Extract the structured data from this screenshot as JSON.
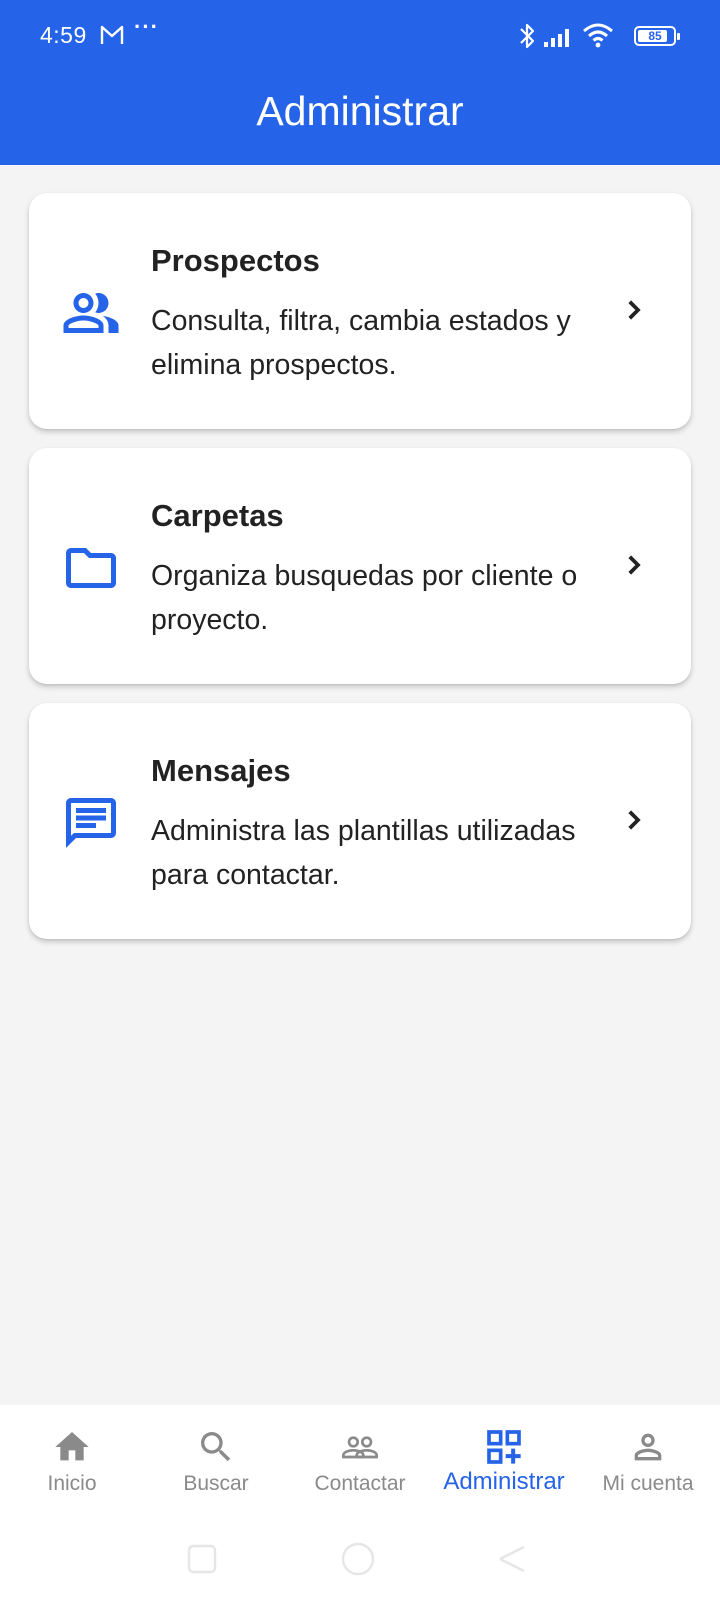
{
  "status_bar": {
    "time": "4:59",
    "battery": "85",
    "battery_percent": 85
  },
  "header": {
    "title": "Administrar"
  },
  "cards": [
    {
      "title": "Prospectos",
      "description": "Consulta, filtra, cambia estados y elimina prospectos.",
      "icon": "people-icon"
    },
    {
      "title": "Carpetas",
      "description": "Organiza busquedas por cliente o proyecto.",
      "icon": "folder-icon"
    },
    {
      "title": "Mensajes",
      "description": "Administra las plantillas utilizadas para contactar.",
      "icon": "message-icon"
    }
  ],
  "bottom_nav": {
    "items": [
      {
        "label": "Inicio",
        "icon": "home-icon",
        "active": false
      },
      {
        "label": "Buscar",
        "icon": "search-icon",
        "active": false
      },
      {
        "label": "Contactar",
        "icon": "contacts-icon",
        "active": false
      },
      {
        "label": "Administrar",
        "icon": "grid-add-icon",
        "active": true
      },
      {
        "label": "Mi cuenta",
        "icon": "person-icon",
        "active": false
      }
    ]
  },
  "colors": {
    "primary": "#2563e8",
    "background": "#f4f4f4",
    "inactive": "#8a8a8a",
    "text": "#222222"
  }
}
